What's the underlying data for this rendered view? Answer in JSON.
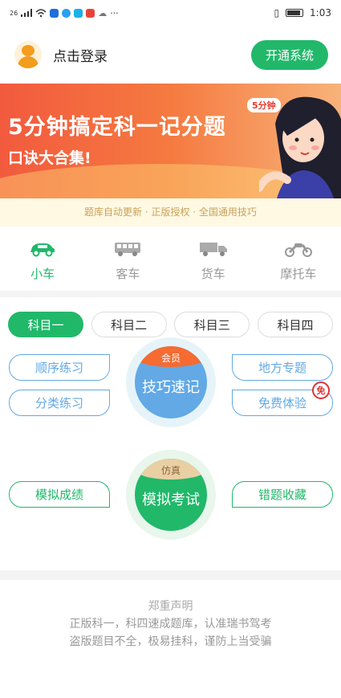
{
  "status": {
    "net": "26",
    "time": "1:03",
    "more": "···"
  },
  "header": {
    "login": "点击登录",
    "open_btn": "开通系统"
  },
  "banner": {
    "title": "5分钟搞定科一记分题",
    "subtitle": "口诀大合集!",
    "tag": "5分钟"
  },
  "notice": "题库自动更新 · 正版授权 · 全国通用技巧",
  "vehicles": [
    {
      "label": "小车",
      "icon": "car-icon",
      "active": true
    },
    {
      "label": "客车",
      "icon": "bus-icon",
      "active": false
    },
    {
      "label": "货车",
      "icon": "truck-icon",
      "active": false
    },
    {
      "label": "摩托车",
      "icon": "motorcycle-icon",
      "active": false
    }
  ],
  "subjects": [
    "科目一",
    "科目二",
    "科目三",
    "科目四"
  ],
  "practice": {
    "order": "顺序练习",
    "category": "分类练习",
    "local": "地方专题",
    "trial": "免费体验",
    "free_badge": "免",
    "member_cap": "会员",
    "skills": "技巧速记",
    "sim_cap": "仿真",
    "exam": "模拟考试",
    "scores": "模拟成绩",
    "mistakes": "错题收藏"
  },
  "declaration": {
    "title": "郑重声明",
    "line1": "正版科一，科四速成题库，认准瑞书驾考",
    "line2": "盗版题目不全，极易挂科，谨防上当受骗"
  },
  "colors": {
    "accent": "#21b86a",
    "blue": "#62a9e6",
    "orange": "#f56b32"
  }
}
